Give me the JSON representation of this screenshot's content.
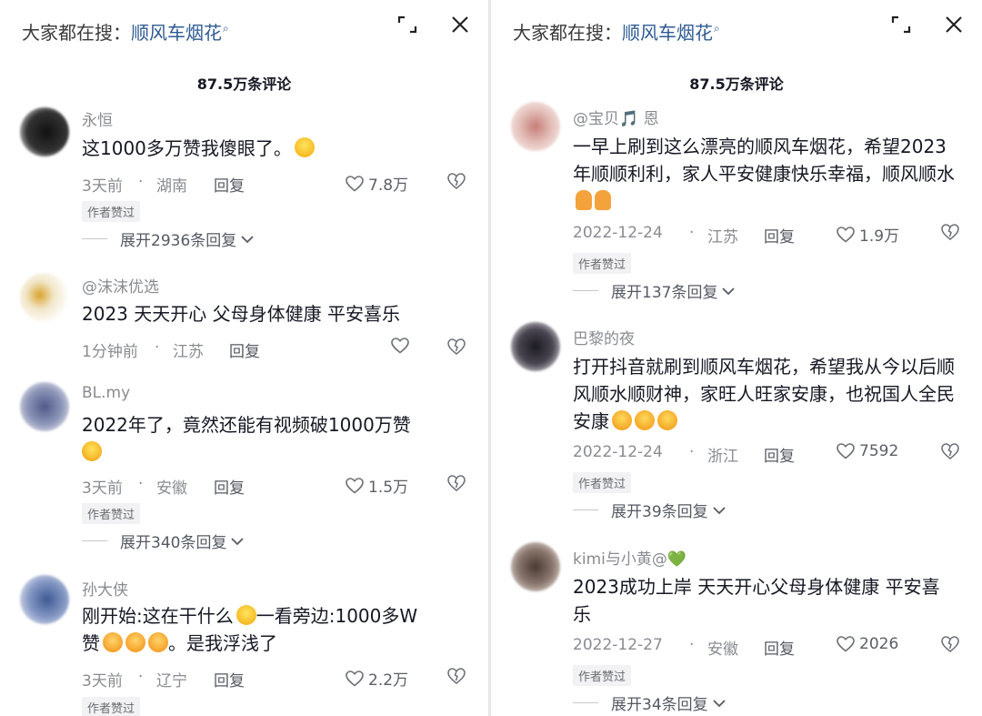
{
  "left": {
    "search_prefix": "大家都在搜：",
    "search_term": "顺风车烟花",
    "search_icon": "search-icon",
    "expand_icon": "expand-icon",
    "close_icon": "close-icon",
    "comment_count": "87.5万条评论",
    "comments": [
      {
        "user": "永恒",
        "text": "这1000多万赞我傻眼了。",
        "emoji": "laugh",
        "time": "3天前",
        "location": "湖南",
        "reply": "回复",
        "likes": "7.8万",
        "badge": "作者赞过",
        "expand": "展开2936条回复",
        "avatar_color": "#1e1e1e"
      },
      {
        "user": "@沫沫优选",
        "text": "2023 天天开心 父母身体健康 平安喜乐",
        "time": "1分钟前",
        "location": "江苏",
        "reply": "回复",
        "likes": "",
        "avatar_color": "#e3d7b4"
      },
      {
        "user": "BL.my",
        "text": "2022年了，竟然还能有视频破1000万赞",
        "emoji": "cry",
        "time": "3天前",
        "location": "安徽",
        "reply": "回复",
        "likes": "1.5万",
        "badge": "作者赞过",
        "expand": "展开340条回复",
        "avatar_color": "#7f88a8"
      },
      {
        "user": "孙大侠",
        "text_a": "刚开始:这在干什么",
        "text_b": "一看旁边:1000多W",
        "text_c": "赞",
        "text_d": "。是我浮浅了",
        "time": "3天前",
        "location": "辽宁",
        "reply": "回复",
        "likes": "2.2万",
        "badge": "作者赞过",
        "avatar_color": "#5c6fa3"
      }
    ]
  },
  "right": {
    "search_prefix": "大家都在搜：",
    "search_term": "顺风车烟花",
    "comment_count": "87.5万条评论",
    "comments": [
      {
        "user": "@宝贝🎵 恩",
        "text": "一早上刷到这么漂亮的顺风车烟花，希望2023年顺顺利利，家人平安健康快乐幸福，顺风顺水",
        "time": "2022-12-24",
        "location": "江苏",
        "reply": "回复",
        "likes": "1.9万",
        "badge": "作者赞过",
        "expand": "展开137条回复",
        "avatar_color": "#d9a9a1"
      },
      {
        "user": "巴黎的夜",
        "text": "打开抖音就刷到顺风车烟花，希望我从今以后顺风顺水顺财神，家旺人旺家安康，也祝国人全民安康",
        "time": "2022-12-24",
        "location": "浙江",
        "reply": "回复",
        "likes": "7592",
        "badge": "作者赞过",
        "expand": "展开39条回复",
        "avatar_color": "#2d2b33"
      },
      {
        "user": "kimi与小黄@💚",
        "text": "2023成功上岸 天天开心父母身体健康 平安喜乐",
        "time": "2022-12-27",
        "location": "安徽",
        "reply": "回复",
        "likes": "2026",
        "badge": "作者赞过",
        "expand": "展开34条回复",
        "avatar_color": "#6b5a52"
      }
    ]
  },
  "dot": "·"
}
